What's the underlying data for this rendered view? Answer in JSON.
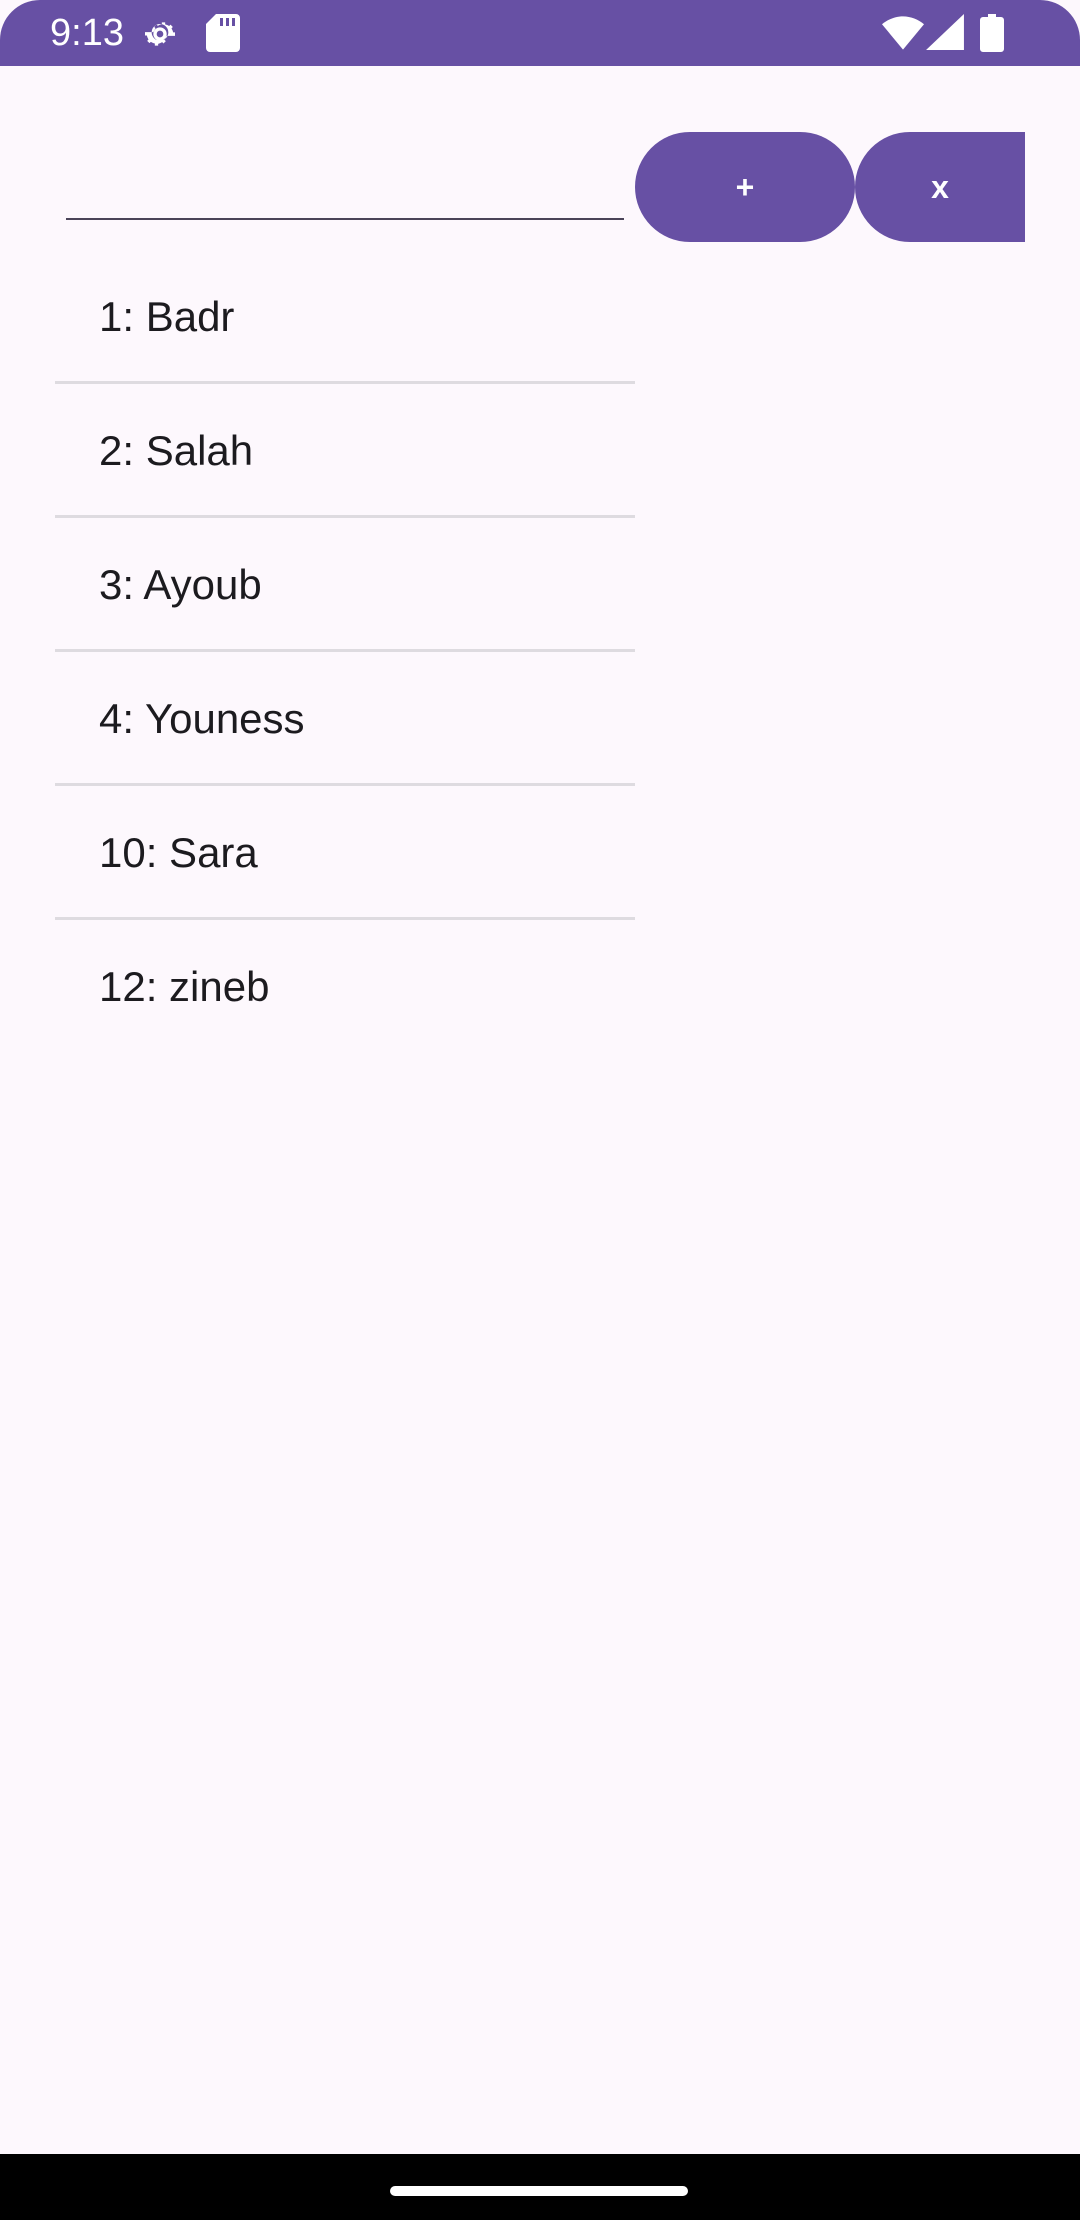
{
  "status_bar": {
    "time": "9:13",
    "icons": [
      "gear-icon",
      "sd-card-icon",
      "wifi-icon",
      "signal-icon",
      "battery-icon"
    ]
  },
  "form": {
    "input_value": "",
    "input_placeholder": "",
    "add_label": "+",
    "clear_label": "x"
  },
  "list": {
    "items": [
      {
        "label": "1: Badr"
      },
      {
        "label": "2: Salah"
      },
      {
        "label": "3: Ayoub"
      },
      {
        "label": "4: Youness"
      },
      {
        "label": "10: Sara"
      },
      {
        "label": "12: zineb"
      }
    ]
  },
  "colors": {
    "accent": "#6750a4",
    "background": "#fdf8fd",
    "divider": "#dedbe0",
    "text": "#1c1b1f"
  }
}
